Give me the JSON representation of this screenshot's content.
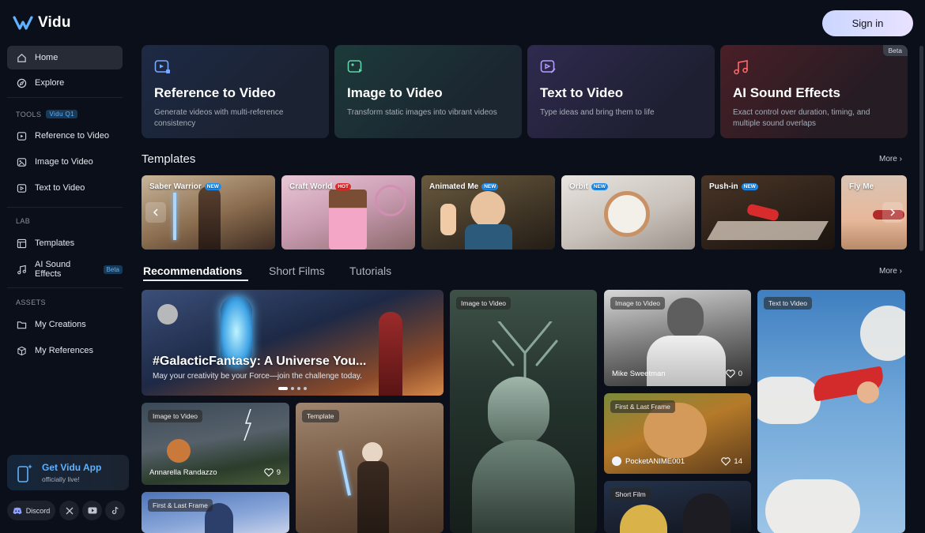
{
  "app": {
    "name": "Vidu",
    "sign_in": "Sign in"
  },
  "sidebar": {
    "items": [
      {
        "label": "Home",
        "icon": "home-icon",
        "active": true
      },
      {
        "label": "Explore",
        "icon": "compass-icon"
      }
    ],
    "tools_heading": "TOOLS",
    "tools_tag": "Vidu Q1",
    "tools": [
      {
        "label": "Reference to Video",
        "icon": "reference-video-icon"
      },
      {
        "label": "Image to Video",
        "icon": "image-video-icon"
      },
      {
        "label": "Text to Video",
        "icon": "text-video-icon"
      }
    ],
    "lab_heading": "LAB",
    "lab": [
      {
        "label": "Templates",
        "icon": "templates-icon"
      },
      {
        "label": "AI Sound Effects",
        "icon": "music-note-icon",
        "tag": "Beta"
      }
    ],
    "assets_heading": "ASSETS",
    "assets": [
      {
        "label": "My Creations",
        "icon": "folder-icon"
      },
      {
        "label": "My References",
        "icon": "cube-icon"
      }
    ],
    "app_promo": {
      "title": "Get Vidu App",
      "subtitle": "officially live!"
    },
    "social": {
      "discord": "Discord"
    }
  },
  "features": [
    {
      "title": "Reference to Video",
      "desc": "Generate videos with multi-reference consistency",
      "icon": "reference-video-icon",
      "color": "#7aa7ff"
    },
    {
      "title": "Image to Video",
      "desc": "Transform static images into vibrant videos",
      "icon": "image-video-icon",
      "color": "#5fd3a8"
    },
    {
      "title": "Text to Video",
      "desc": "Type ideas and bring them to life",
      "icon": "text-video-icon",
      "color": "#b69cff"
    },
    {
      "title": "AI Sound Effects",
      "desc": "Exact control over duration, timing, and multiple sound overlaps",
      "icon": "music-note-icon",
      "color": "#ff6b6b",
      "badge": "Beta"
    }
  ],
  "templates": {
    "heading": "Templates",
    "more": "More",
    "items": [
      {
        "label": "Saber Warrior",
        "badge": "NEW"
      },
      {
        "label": "Craft World",
        "badge": "HOT"
      },
      {
        "label": "Animated Me",
        "badge": "NEW"
      },
      {
        "label": "Orbit",
        "badge": "NEW"
      },
      {
        "label": "Push-in",
        "badge": "NEW"
      },
      {
        "label": "Fly Me",
        "badge": ""
      }
    ]
  },
  "feed": {
    "tabs": [
      "Recommendations",
      "Short Films",
      "Tutorials"
    ],
    "more": "More",
    "hero": {
      "title": "#GalacticFantasy: A Universe You...",
      "subtitle": "May your creativity be your Force—join the challenge today."
    },
    "cards": [
      {
        "tag": "Image to Video",
        "author": "Annarella Randazzo",
        "likes": "9"
      },
      {
        "tag": "Template",
        "author": "",
        "likes": ""
      },
      {
        "tag": "First & Last Frame",
        "author": "",
        "likes": ""
      },
      {
        "tag": "Image to Video",
        "author": "",
        "likes": ""
      },
      {
        "tag": "Image to Video",
        "author": "Mike Sweetman",
        "likes": "0"
      },
      {
        "tag": "First & Last Frame",
        "author": "PocketANIME001",
        "likes": "14"
      },
      {
        "tag": "Short Film",
        "author": "",
        "likes": ""
      },
      {
        "tag": "Text to Video",
        "author": "",
        "likes": ""
      }
    ]
  }
}
